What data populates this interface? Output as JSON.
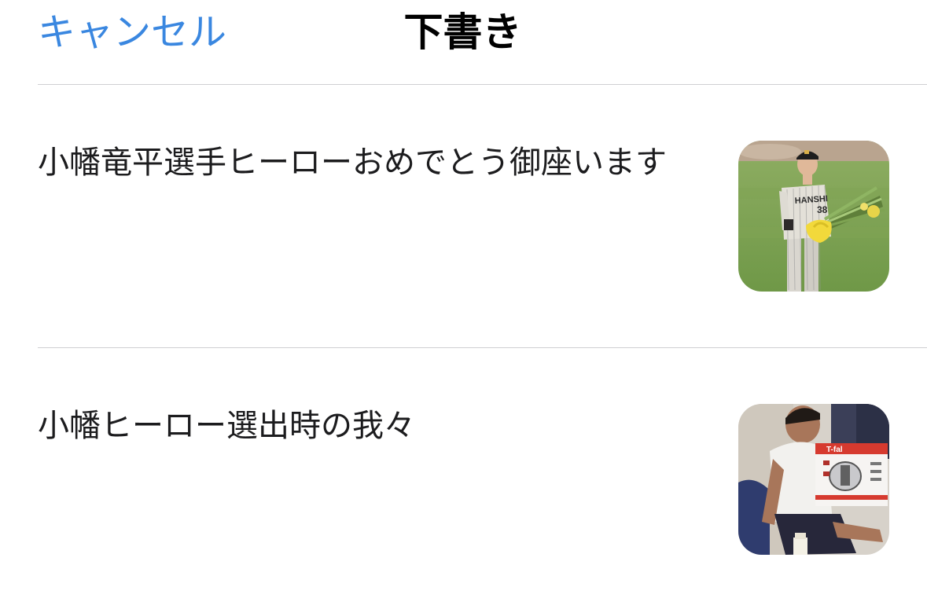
{
  "nav": {
    "cancel_label": "キャンセル",
    "title": "下書き"
  },
  "drafts": [
    {
      "text": "小幡竜平選手ヒーローおめでとう御座います",
      "thumbnail": {
        "description_icon": "photo-thumbnail",
        "jersey_text": "HANSHIN",
        "jersey_number": "38"
      }
    },
    {
      "text": "小幡ヒーロー選出時の我々",
      "thumbnail": {
        "description_icon": "photo-thumbnail",
        "box_brand": "T-fal"
      }
    }
  ],
  "colors": {
    "accent": "#3a87e0",
    "separator": "#cfcfd2",
    "text": "#1c1c1e"
  }
}
